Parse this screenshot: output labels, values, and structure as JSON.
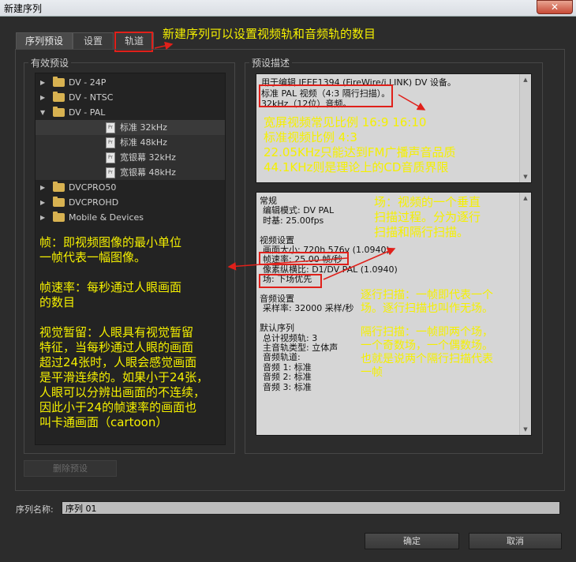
{
  "window": {
    "title": "新建序列",
    "close_glyph": "✕"
  },
  "tabs": [
    "序列预设",
    "设置",
    "轨道"
  ],
  "left_panel": {
    "label": "有效预设",
    "items": [
      {
        "label": "DV - 24P",
        "type": "folder",
        "expanded": false
      },
      {
        "label": "DV - NTSC",
        "type": "folder",
        "expanded": false
      },
      {
        "label": "DV - PAL",
        "type": "folder",
        "expanded": true
      },
      {
        "label": "标准 32kHz",
        "type": "preset",
        "selected": true
      },
      {
        "label": "标准 48kHz",
        "type": "preset"
      },
      {
        "label": "宽银幕 32kHz",
        "type": "preset"
      },
      {
        "label": "宽银幕 48kHz",
        "type": "preset"
      },
      {
        "label": "DVCPRO50",
        "type": "folder",
        "expanded": false
      },
      {
        "label": "DVCPROHD",
        "type": "folder",
        "expanded": false
      },
      {
        "label": "Mobile & Devices",
        "type": "folder",
        "expanded": false
      }
    ],
    "delete_button": "删除预设"
  },
  "right_panel": {
    "label": "预设描述",
    "description_lines": [
      "用于编辑 IEEE1394 (FireWire/i.LINK) DV 设备。",
      "标准 PAL 视频（4:3 隔行扫描）。",
      "32kHz（12位）音频。"
    ],
    "details_lines": [
      "常规",
      "编辑模式: DV PAL",
      "时基: 25.00fps",
      "",
      "视频设置",
      "画面大小: 720h 576v (1.0940)",
      "帧速率: 25.00 帧/秒",
      "像素纵横比: D1/DV PAL (1.0940)",
      "场: 下场优先",
      "",
      "音频设置",
      "采样率: 32000 采样/秒",
      "",
      "默认序列",
      "总计视频轨: 3",
      "主音轨类型: 立体声",
      "音频轨道:",
      "音频 1: 标准",
      "音频 2: 标准",
      "音频 3: 标准"
    ]
  },
  "annotations": {
    "tracks_note": "新建序列可以设置视频轨和音频轨的数目",
    "aspect_note": "宽屏视频常见比例 16:9 16:10\n标准视频比例 4:3\n22.05KHz只能达到FM广播声音品质\n44.1KHz则是理论上的CD音质界限",
    "field_note": "场：视频的一个垂直\n扫描过程。分为逐行\n扫描和隔行扫描。",
    "progressive_note": "逐行扫描：一帧即代表一个\n场。逐行扫描也叫作无场。",
    "interlaced_note": "隔行扫描：一帧即两个场，\n一个奇数场，一个偶数场。\n也就是说两个隔行扫描代表\n一帧",
    "frame_note": "帧：即视频图像的最小单位\n一帧代表一幅图像。\n\n帧速率：每秒通过人眼画面\n的数目\n\n视觉暂留：人眼具有视觉暂留\n特征，当每秒通过人眼的画面\n超过24张时，人眼会感觉画面\n是平滑连续的。如果小于24张，\n人眼可以分辨出画面的不连续，\n因此小于24的帧速率的画面也\n叫卡通画面（cartoon）"
  },
  "footer": {
    "name_label": "序列名称:",
    "name_value": "序列 01",
    "ok_button": "确定",
    "cancel_button": "取消"
  }
}
